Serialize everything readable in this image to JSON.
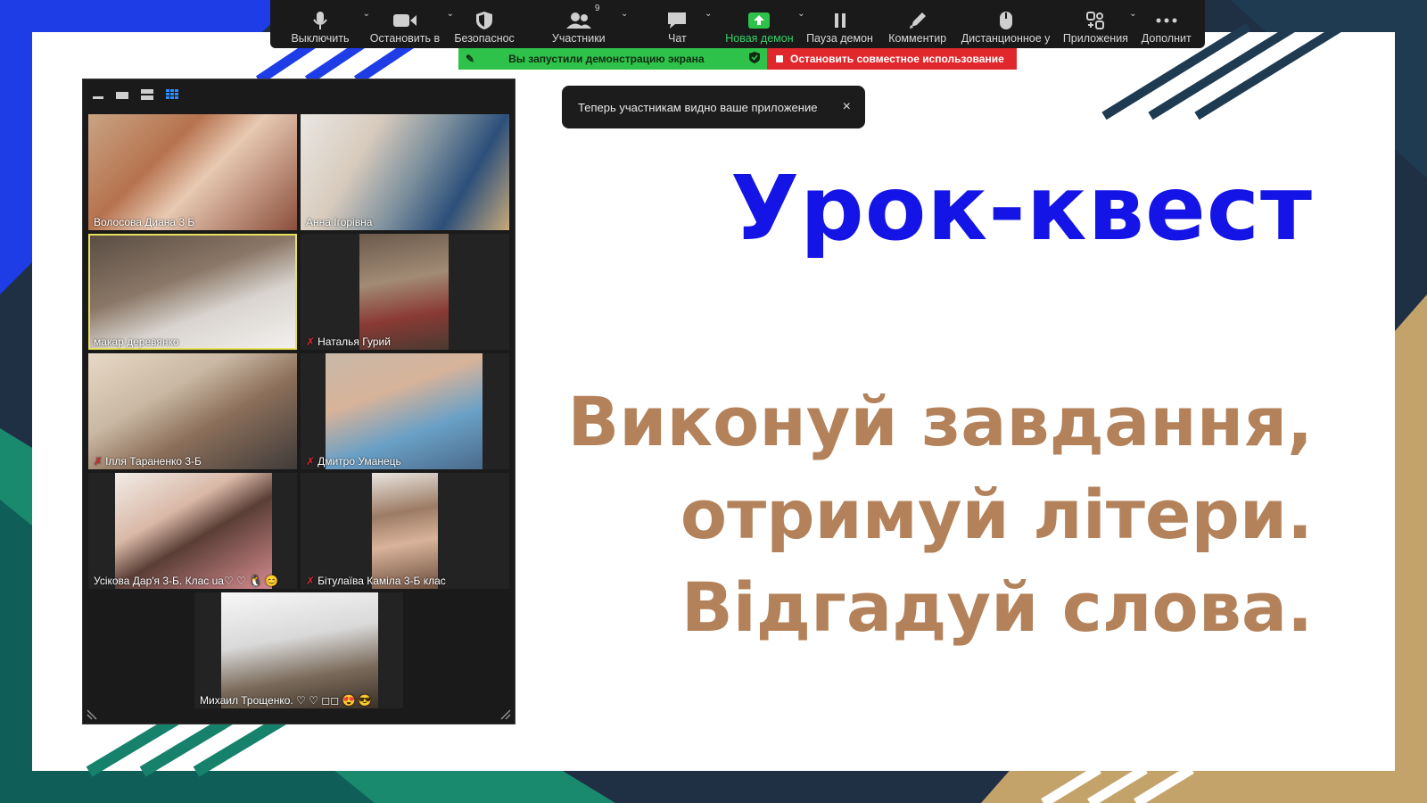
{
  "toolbar": {
    "items": [
      {
        "label": "Выключить",
        "icon": "microphone-icon"
      },
      {
        "label": "Остановить в",
        "icon": "video-camera-icon"
      },
      {
        "label": "Безопаснос",
        "icon": "shield-icon"
      },
      {
        "label": "Участники",
        "icon": "participants-icon",
        "count": "9"
      },
      {
        "label": "Чат",
        "icon": "chat-icon"
      },
      {
        "label": "Новая демон",
        "icon": "share-screen-icon"
      },
      {
        "label": "Пауза демон",
        "icon": "pause-icon"
      },
      {
        "label": "Комментир",
        "icon": "annotate-icon"
      },
      {
        "label": "Дистанционное у",
        "icon": "remote-control-icon"
      },
      {
        "label": "Приложения",
        "icon": "apps-icon"
      },
      {
        "label": "Дополнит",
        "icon": "more-icon"
      }
    ]
  },
  "share_banner": {
    "status": "Вы запустили демонстрацию экрана",
    "stop": "Остановить совместное использование"
  },
  "toast": {
    "message": "Теперь участникам видно ваше приложение",
    "close": "×"
  },
  "participants": [
    {
      "name": "Волосова Диана 3 Б",
      "muted": false
    },
    {
      "name": "Анна Ігорівна",
      "muted": false
    },
    {
      "name": "макар  деревянко",
      "muted": false
    },
    {
      "name": "Наталья Гурий",
      "muted": true
    },
    {
      "name": "Ілля Тараненко 3-Б",
      "muted": true
    },
    {
      "name": "Дмитро Уманець",
      "muted": true
    },
    {
      "name": "Усікова Дар'я 3-Б. Клас ua♡ ♡ 🐧 😊",
      "muted": false
    },
    {
      "name": "Бітулаїва Каміла 3-Б клас",
      "muted": true
    },
    {
      "name": "Михаил Трощенко. ♡ ♡ ◻◻ 😍 😎",
      "muted": false
    }
  ],
  "slide": {
    "title": "Урок-квест",
    "line1": "Виконуй завдання,",
    "line2": "отримуй літери.",
    "line3": "Відгадуй слова."
  },
  "colors": {
    "title": "#1414e6",
    "body": "#b3825a",
    "accent_green": "#2fc24a",
    "stop_red": "#e0282c"
  }
}
